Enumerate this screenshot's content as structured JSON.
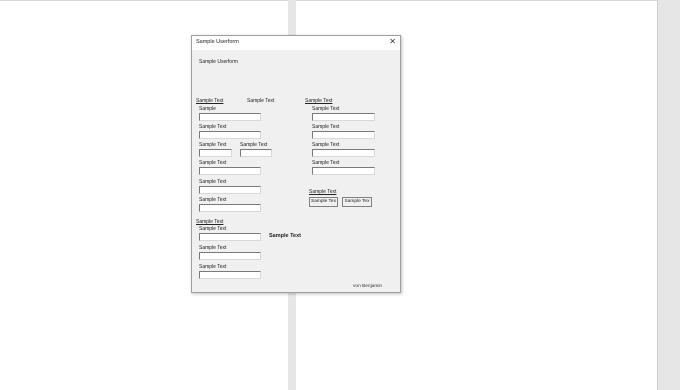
{
  "form": {
    "title": "Sample Userform",
    "close_glyph": "✕",
    "heading": "Sample Userform",
    "footer": "von Benjamin"
  },
  "labels": {
    "group_left_1": "Sample Text",
    "top_middle": "Sample Text",
    "group_right": "Sample Text",
    "l1": "Sample",
    "l2": "Sample Text",
    "l3a": "Sample Text",
    "l3b": "Sample Text",
    "l4": "Sample Text",
    "l5": "Sample Text",
    "l6": "Sample Text",
    "r1": "Sample Text",
    "r2": "Sample Text",
    "r3": "Sample Text",
    "r4": "Sample Text",
    "r_group2": "Sample Text",
    "group_left_2": "Sample Text",
    "g2_1": "Sample Text",
    "g2_2": "Sample Text",
    "g2_3": "Sample Text",
    "bold_middle": "Sample Text"
  },
  "buttons": {
    "b1": "Sample Tex",
    "b2": "Sample Tex"
  }
}
